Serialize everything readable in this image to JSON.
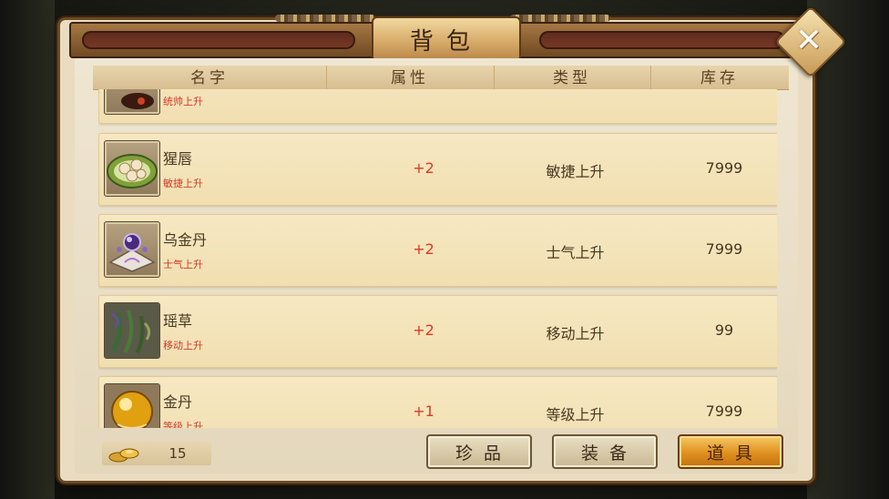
{
  "window": {
    "title": "背包",
    "close_label": "✕"
  },
  "table": {
    "columns": [
      "名字",
      "属性",
      "类型",
      "库存"
    ]
  },
  "items": [
    {
      "name": "",
      "desc": "统帅上升",
      "attr": "",
      "type": "",
      "stock": "",
      "icon": "bowl-icon"
    },
    {
      "name": "猩唇",
      "desc": "敏捷上升",
      "attr": "+2",
      "type": "敏捷上升",
      "stock": "7999",
      "icon": "dumpling-plate-icon"
    },
    {
      "name": "乌金丹",
      "desc": "士气上升",
      "attr": "+2",
      "type": "士气上升",
      "stock": "7999",
      "icon": "pill-orb-icon"
    },
    {
      "name": "瑶草",
      "desc": "移动上升",
      "attr": "+2",
      "type": "移动上升",
      "stock": "99",
      "icon": "herb-icon"
    },
    {
      "name": "金丹",
      "desc": "等级上升",
      "attr": "+1",
      "type": "等级上升",
      "stock": "7999",
      "icon": "golden-pill-icon"
    }
  ],
  "footer": {
    "gold": "15",
    "tabs": [
      {
        "label": "珍品",
        "active": false
      },
      {
        "label": "装备",
        "active": false
      },
      {
        "label": "道具",
        "active": true
      }
    ]
  },
  "colors": {
    "attr_red": "#d83a2a",
    "active_tab": "#e0901f"
  }
}
